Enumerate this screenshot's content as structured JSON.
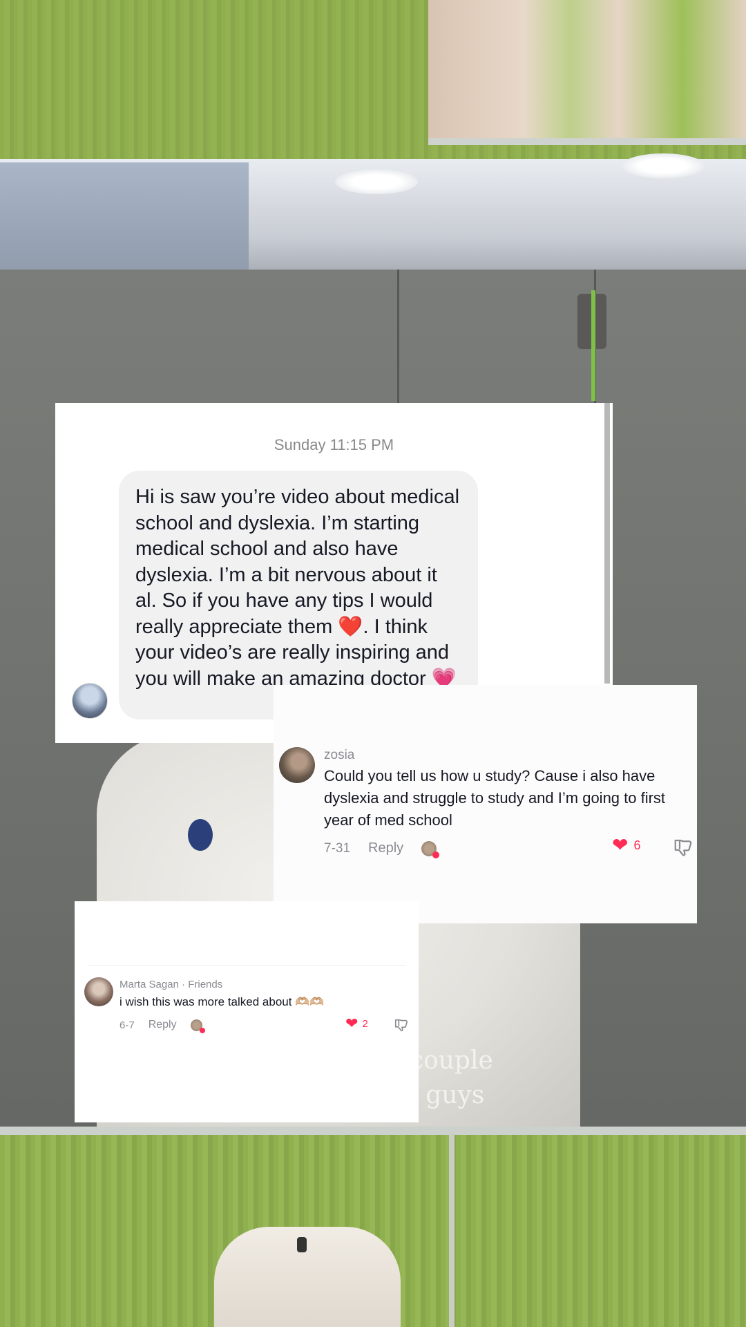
{
  "video": {
    "caption_lines": [
      "a couple",
      "ou guys"
    ]
  },
  "dm": {
    "timestamp": "Sunday 11:15 PM",
    "message_part1": "Hi is saw you’re video about medical school and dyslexia. I’m starting medical school and also have dyslexia. I’m a bit nervous about it al. So if you have any tips I would really appreciate them ",
    "message_emoji1": "❤️",
    "message_part2": ". I think your video’s are really inspiring and you will make an amazing doctor ",
    "message_emoji2": "💗"
  },
  "comment1": {
    "username": "zosia",
    "text": "Could you tell us how u study? Cause i also have dyslexia and struggle to study and I’m going to first year of med school",
    "date": "7-31",
    "reply_label": "Reply",
    "like_count": "6"
  },
  "comment2": {
    "username": "Marta Sagan · Friends",
    "text": "i wish this was more talked about 🫶🏼🫶🏼",
    "date": "6-7",
    "reply_label": "Reply",
    "like_count": "2"
  },
  "colors": {
    "like_red": "#fe2c55",
    "bubble_gray": "#f1f1f2",
    "meta_gray": "#8a8b91"
  }
}
